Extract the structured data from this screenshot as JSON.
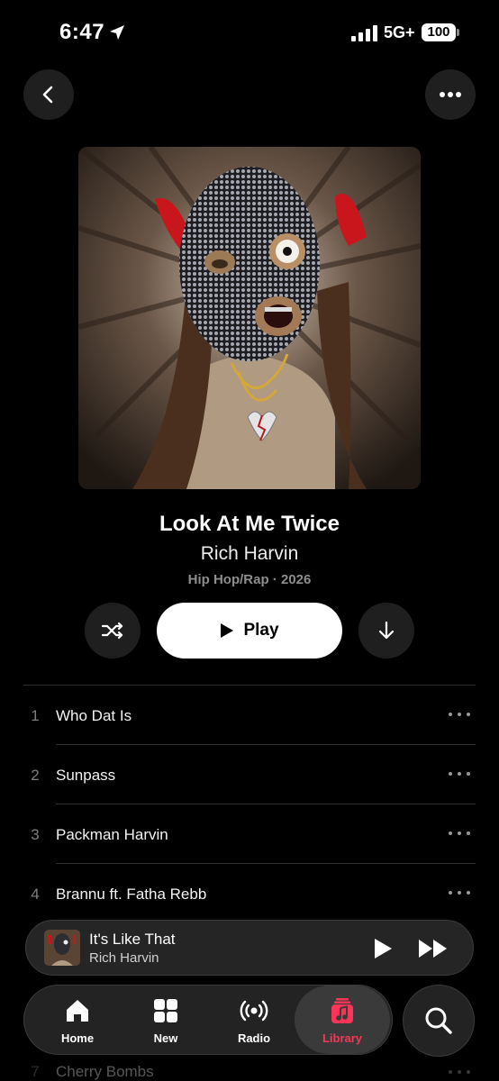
{
  "status": {
    "time": "6:47",
    "network": "5G+",
    "battery": "100"
  },
  "album": {
    "title": "Look At Me Twice",
    "artist": "Rich Harvin",
    "meta": "Hip Hop/Rap · 2026",
    "play_label": "Play"
  },
  "tracks": [
    {
      "number": "1",
      "title": "Who Dat Is"
    },
    {
      "number": "2",
      "title": "Sunpass"
    },
    {
      "number": "3",
      "title": "Packman Harvin"
    },
    {
      "number": "4",
      "title": "Brannu ft. Fatha Rebb"
    },
    {
      "number": "7",
      "title": "Cherry Bombs"
    }
  ],
  "now_playing": {
    "title": "It's Like That",
    "artist": "Rich Harvin"
  },
  "tabs": [
    {
      "label": "Home",
      "icon": "home-icon"
    },
    {
      "label": "New",
      "icon": "grid-icon"
    },
    {
      "label": "Radio",
      "icon": "radio-icon"
    },
    {
      "label": "Library",
      "icon": "library-icon",
      "active": true
    }
  ],
  "colors": {
    "accent": "#fa3555",
    "background": "#000000",
    "surface": "#1f1f1f"
  }
}
